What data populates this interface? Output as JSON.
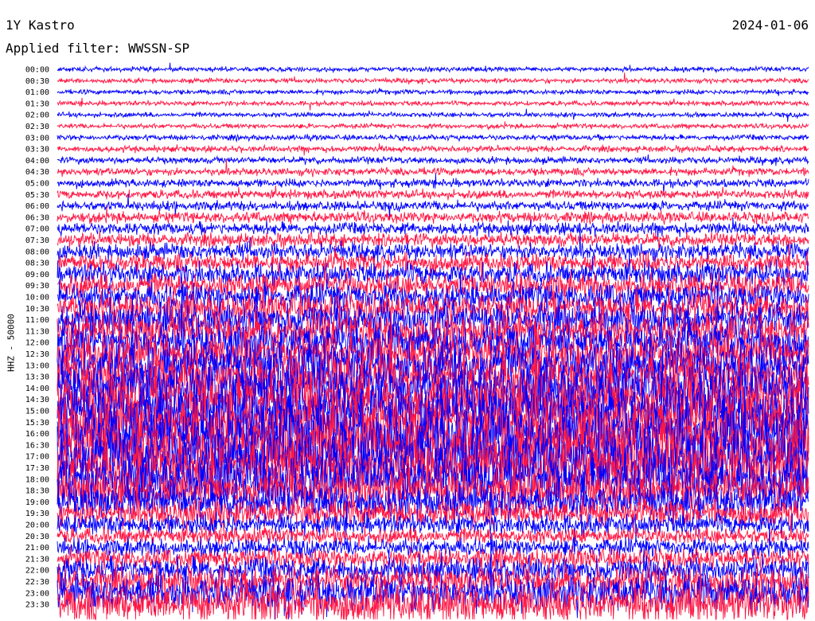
{
  "header": {
    "station": "1Y Kastro",
    "date": "2024-01-06",
    "filter": "Applied filter: WWSSN-SP"
  },
  "axis": {
    "ylabel": "HHZ - 50000"
  },
  "colors": {
    "trace_a": "#0000ff",
    "trace_b": "#ff1744",
    "background": "#ffffff"
  },
  "chart_data": {
    "type": "line",
    "title": "1Y Kastro",
    "subtitle": "Applied filter: WWSSN-SP",
    "xlabel": "",
    "ylabel": "HHZ - 50000",
    "row_labels": [
      "00:00",
      "00:30",
      "01:00",
      "01:30",
      "02:00",
      "02:30",
      "03:00",
      "03:30",
      "04:00",
      "04:30",
      "05:00",
      "05:30",
      "06:00",
      "06:30",
      "07:00",
      "07:30",
      "08:00",
      "08:30",
      "09:00",
      "09:30",
      "10:00",
      "10:30",
      "11:00",
      "11:30",
      "12:00",
      "12:30",
      "13:00",
      "13:30",
      "14:00",
      "14:30",
      "15:00",
      "15:30",
      "16:00",
      "16:30",
      "17:00",
      "17:30",
      "18:00",
      "18:30",
      "19:00",
      "19:30",
      "20:00",
      "20:30",
      "21:00",
      "21:30",
      "22:00",
      "22:30",
      "23:00",
      "23:30"
    ],
    "series": [
      {
        "color": "#0000ff",
        "rows": "even"
      },
      {
        "color": "#ff1744",
        "rows": "odd"
      }
    ],
    "relative_amplitude": [
      0.35,
      0.35,
      0.35,
      0.35,
      0.35,
      0.35,
      0.4,
      0.45,
      0.5,
      0.55,
      0.6,
      0.65,
      0.7,
      0.8,
      0.9,
      1.0,
      1.2,
      1.4,
      1.6,
      1.8,
      2.0,
      2.2,
      2.4,
      2.6,
      2.8,
      3.0,
      3.2,
      3.4,
      3.6,
      3.8,
      4.0,
      4.2,
      4.4,
      4.4,
      4.2,
      4.0,
      3.6,
      3.0,
      2.6,
      2.0,
      1.5,
      1.2,
      1.3,
      1.5,
      1.8,
      2.2,
      2.6,
      3.0
    ],
    "grid": false,
    "legend": "none"
  }
}
